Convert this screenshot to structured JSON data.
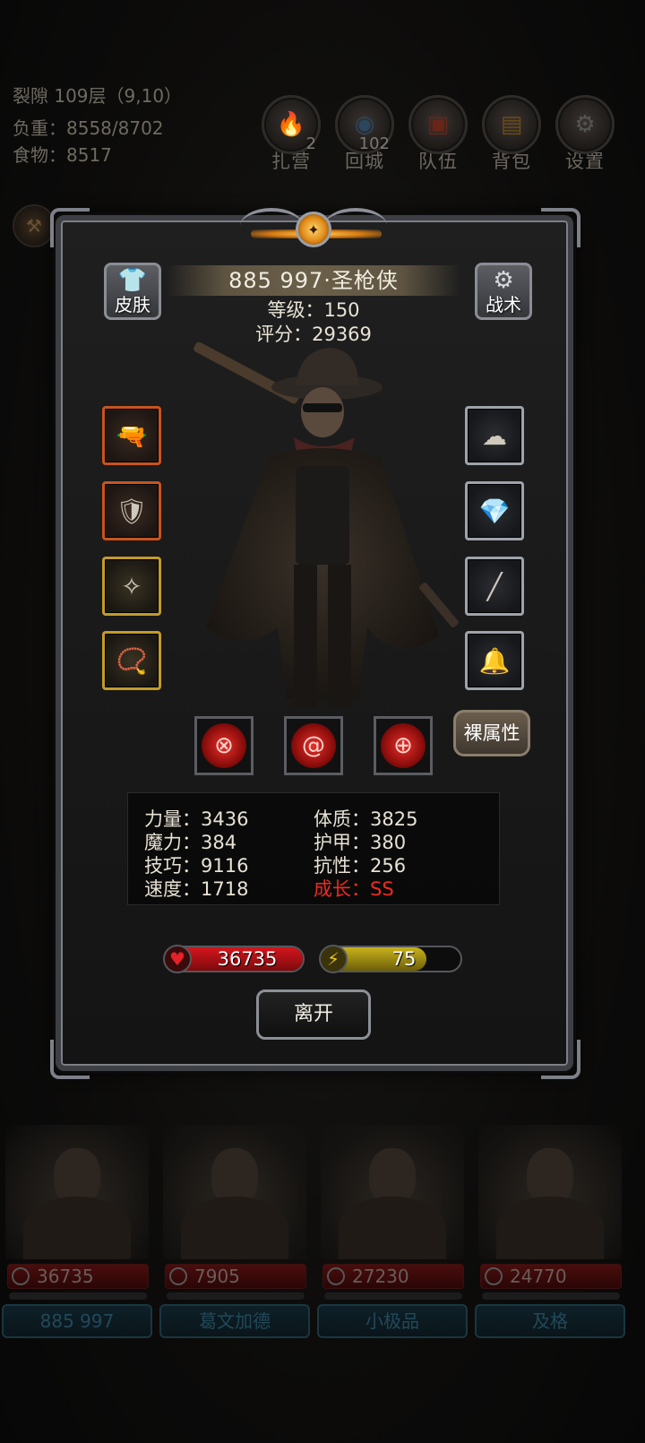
{
  "hud": {
    "location": "裂隙 109层（9,10）",
    "weight": "负重：8558/8702",
    "food": "食物：8517"
  },
  "top_buttons": [
    {
      "label": "扎营",
      "badge": "2",
      "icon": "campfire-icon"
    },
    {
      "label": "回城",
      "badge": "102",
      "icon": "portal-icon"
    },
    {
      "label": "队伍",
      "badge": "",
      "icon": "team-icon"
    },
    {
      "label": "背包",
      "badge": "",
      "icon": "backpack-icon"
    },
    {
      "label": "设置",
      "badge": "",
      "icon": "gear-icon"
    }
  ],
  "character": {
    "name": "885 997·圣枪侠",
    "level": "等级：150",
    "score": "评分：29369",
    "skin_label": "皮肤",
    "tactics_label": "战术",
    "raw_attr_label": "裸属性"
  },
  "equipment_left": [
    {
      "icon": "flintlock-pistol-icon",
      "rarity": "orange"
    },
    {
      "icon": "chest-armor-icon",
      "rarity": "orange"
    },
    {
      "icon": "winged-amulet-icon",
      "rarity": "gold"
    },
    {
      "icon": "pendant-necklace-icon",
      "rarity": "gold"
    }
  ],
  "equipment_right": [
    {
      "icon": "cloud-ring-icon",
      "rarity": "gray"
    },
    {
      "icon": "gem-stone-icon",
      "rarity": "gray"
    },
    {
      "icon": "staff-icon",
      "rarity": "gray"
    },
    {
      "icon": "bell-icon",
      "rarity": "gray"
    }
  ],
  "skills": [
    {
      "icon": "crosshair-skill-icon",
      "glyph": "⊗"
    },
    {
      "icon": "swirl-skill-icon",
      "glyph": "@"
    },
    {
      "icon": "target-skill-icon",
      "glyph": "⊕"
    }
  ],
  "stats": {
    "strength": "力量：3436",
    "constitution": "体质：3825",
    "magic": "魔力：384",
    "armor": "护甲：380",
    "skill": "技巧：9116",
    "resistance": "抗性：256",
    "speed": "速度：1718",
    "growth": "成长：SS"
  },
  "hp_bar": {
    "value": "36735",
    "fill_fraction": 1.0,
    "color": "#d3161c"
  },
  "energy_bar": {
    "value": "75",
    "fill_fraction": 0.75,
    "color": "#c8b21c"
  },
  "leave_label": "离开",
  "party": [
    {
      "hp": "36735",
      "name": "885 997"
    },
    {
      "hp": "7905",
      "name": "葛文加德"
    },
    {
      "hp": "27230",
      "name": "小极品"
    },
    {
      "hp": "24770",
      "name": "及格"
    }
  ]
}
